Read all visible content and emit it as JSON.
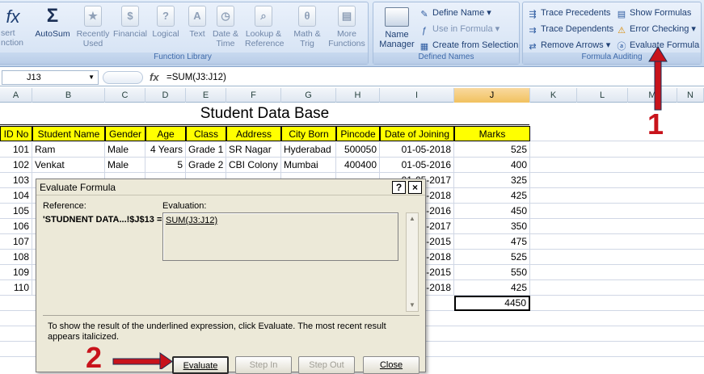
{
  "ribbon": {
    "function_library": {
      "insert_function": "sert\nnction",
      "buttons": [
        {
          "label": "AutoSum",
          "icon": "sigma-icon",
          "glyph": "Σ",
          "active": true
        },
        {
          "label": "Recently Used",
          "icon": "book-recent-icon",
          "glyph": "★"
        },
        {
          "label": "Financial",
          "icon": "book-financial-icon",
          "glyph": "$"
        },
        {
          "label": "Logical",
          "icon": "book-logical-icon",
          "glyph": "?"
        },
        {
          "label": "Text",
          "icon": "book-text-icon",
          "glyph": "A"
        },
        {
          "label": "Date & Time",
          "icon": "book-date-icon",
          "glyph": "◷"
        },
        {
          "label": "Lookup & Reference",
          "icon": "book-lookup-icon",
          "glyph": "⌕"
        },
        {
          "label": "Math & Trig",
          "icon": "book-math-icon",
          "glyph": "θ"
        },
        {
          "label": "More Functions",
          "icon": "book-more-icon",
          "glyph": "▤"
        }
      ],
      "label": "Function Library"
    },
    "defined_names": {
      "name_manager": "Name Manager",
      "define_name": "Define Name",
      "use_in_formula": "Use in Formula",
      "create_from_selection": "Create from Selection",
      "label": "Defined Names"
    },
    "formula_auditing": {
      "trace_precedents": "Trace Precedents",
      "trace_dependents": "Trace Dependents",
      "remove_arrows": "Remove Arrows",
      "show_formulas": "Show Formulas",
      "error_checking": "Error Checking",
      "evaluate_formula": "Evaluate Formula",
      "label": "Formula Auditing"
    }
  },
  "formula_bar": {
    "cell_ref": "J13",
    "fx": "fx",
    "formula": "=SUM(J3:J12)"
  },
  "columns": [
    "A",
    "B",
    "C",
    "D",
    "E",
    "F",
    "G",
    "H",
    "I",
    "J",
    "K",
    "L",
    "M",
    "N"
  ],
  "sheet": {
    "title": "Student Data Base",
    "headers": [
      "ID No",
      "Student Name",
      "Gender",
      "Age",
      "Class",
      "Address",
      "City Born",
      "Pincode",
      "Date of Joining",
      "Marks"
    ],
    "rows": [
      [
        "101",
        "Ram",
        "Male",
        "4 Years",
        "Grade 1",
        "SR Nagar",
        "Hyderabad",
        "500050",
        "01-05-2018",
        "525"
      ],
      [
        "102",
        "Venkat",
        "Male",
        "5",
        "Grade 2",
        "CBI Colony",
        "Mumbai",
        "400400",
        "01-05-2016",
        "400"
      ],
      [
        "103",
        "",
        "",
        "",
        "",
        "",
        "",
        "",
        "01-05-2017",
        "325"
      ],
      [
        "104",
        "",
        "",
        "",
        "",
        "",
        "",
        "",
        "01-05-2018",
        "425"
      ],
      [
        "105",
        "",
        "",
        "",
        "",
        "",
        "",
        "",
        "01-05-2016",
        "450"
      ],
      [
        "106",
        "",
        "",
        "",
        "",
        "",
        "",
        "",
        "01-05-2017",
        "350"
      ],
      [
        "107",
        "",
        "",
        "",
        "",
        "",
        "",
        "",
        "01-05-2015",
        "475"
      ],
      [
        "108",
        "",
        "",
        "",
        "",
        "",
        "",
        "",
        "01-05-2018",
        "525"
      ],
      [
        "109",
        "",
        "",
        "",
        "",
        "",
        "",
        "",
        "01-05-2015",
        "550"
      ],
      [
        "110",
        "",
        "",
        "",
        "",
        "",
        "",
        "",
        "01-05-2018",
        "425"
      ]
    ],
    "total": "4450"
  },
  "dialog": {
    "title": "Evaluate Formula",
    "help": "?",
    "close": "×",
    "reference_label": "Reference:",
    "reference_value": "'STUDNENT DATA...!$J$13 =",
    "evaluation_label": "Evaluation:",
    "evaluation_value": "SUM(J3:J12)",
    "note": "To show the result of the underlined expression, click Evaluate.  The most recent result appears italicized.",
    "buttons": {
      "evaluate": "Evaluate",
      "step_in": "Step In",
      "step_out": "Step Out",
      "close": "Close"
    }
  },
  "annotations": {
    "marker_1": "1",
    "marker_2": "2",
    "arrow_color": "#c8131b"
  }
}
